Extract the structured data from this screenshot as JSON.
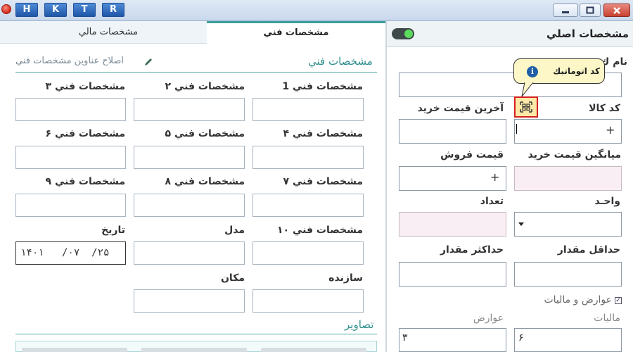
{
  "toolbar": {
    "letters": [
      "H",
      "K",
      "T",
      "R"
    ],
    "minimize_icon": "minimize-icon",
    "maximize_icon": "maximize-icon",
    "close_icon": "close-icon"
  },
  "tabs": {
    "financial": "مشخصات مالي",
    "technical": "مشخصات فني"
  },
  "technical": {
    "section_title": "مشخصات فني",
    "fix_titles_link": "اصلاح عناوين مشخصات فني",
    "fields": {
      "f1": "مشخصات فني 1",
      "f2": "مشخصات فني ۲",
      "f3": "مشخصات فني ۳",
      "f4": "مشخصات فني ۴",
      "f5": "مشخصات فني ۵",
      "f6": "مشخصات فني ۶",
      "f7": "مشخصات فني ۷",
      "f8": "مشخصات فني ۸",
      "f9": "مشخصات فني ۹",
      "f10": "مشخصات فني ۱۰",
      "model": "مدل",
      "date": "تاريخ",
      "maker": "سازنده",
      "place": "مكان"
    },
    "date_value": "۱۴۰۱   /۰۷  /۲۵",
    "images_title": "تصاوير"
  },
  "basic": {
    "title": "مشخصات اصلي",
    "name_label": "نام ك",
    "code_label": "كد كالا",
    "last_price_label": "آخرين قيمت خريد",
    "avg_price_label": "ميانگين قيمت خريد",
    "sale_price_label": "قيمت فروش",
    "unit_label": "واحـد",
    "count_label": "تعداد",
    "min_label": "حداقل مقدار",
    "max_label": "حداكثر مقدار",
    "duties_label": "عوارض و ماليات",
    "duties_checked": "✓",
    "tax_label": "ماليات",
    "duty_label": "عوارض",
    "tax_value": "۶",
    "duty_value": "۳",
    "plus": "+",
    "tooltip": "كد اتوماتيك",
    "info": "i"
  }
}
